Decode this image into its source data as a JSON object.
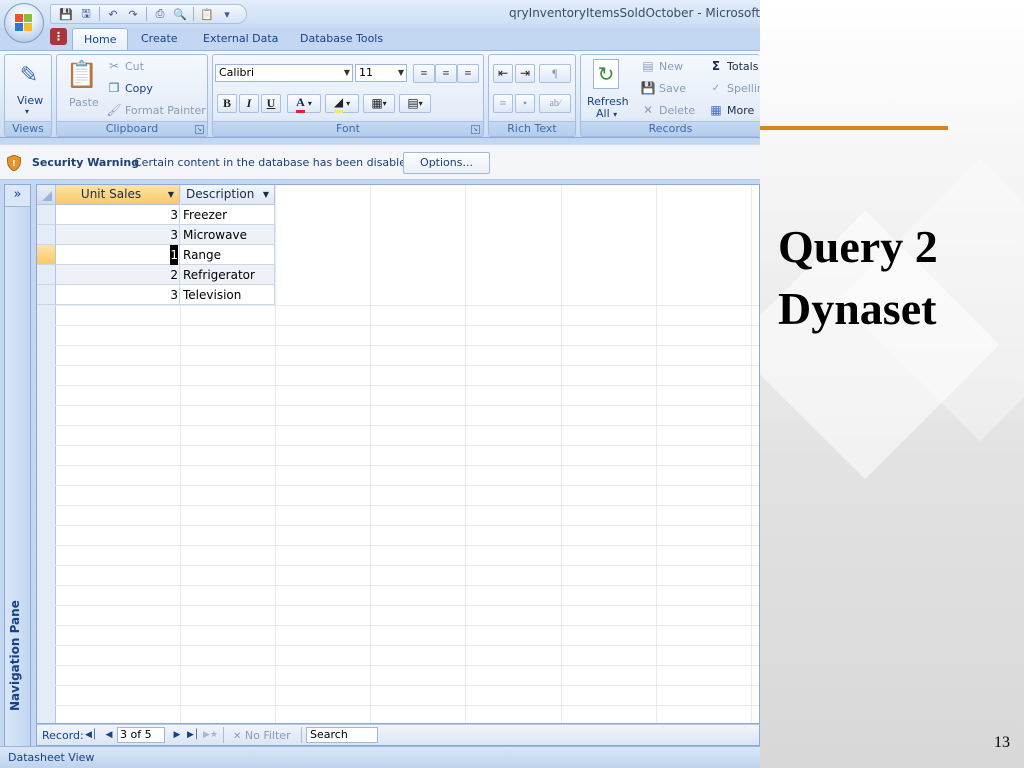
{
  "window": {
    "title": "qryInventoryItemsSoldOctober - Microsoft Acce"
  },
  "tabs": [
    "Home",
    "Create",
    "External Data",
    "Database Tools"
  ],
  "ribbon": {
    "views": {
      "view_label": "View",
      "group_label": "Views"
    },
    "clipboard": {
      "paste": "Paste",
      "cut": "Cut",
      "copy": "Copy",
      "format_painter": "Format Painter",
      "group_label": "Clipboard"
    },
    "font": {
      "font_name": "Calibri",
      "font_size": "11",
      "group_label": "Font"
    },
    "rich_text": {
      "group_label": "Rich Text"
    },
    "records": {
      "refresh_line1": "Refresh",
      "refresh_line2": "All",
      "new": "New",
      "save": "Save",
      "delete": "Delete",
      "totals": "Totals",
      "spelling": "Spellin",
      "more": "More",
      "group_label": "Records"
    }
  },
  "security": {
    "title": "Security Warning",
    "message": "Certain content in the database has been disabled",
    "options_label": "Options..."
  },
  "nav_pane": {
    "label": "Navigation Pane",
    "toggle": "»"
  },
  "datasheet": {
    "columns": [
      "Unit Sales",
      "Description"
    ],
    "rows": [
      {
        "unit_sales": "3",
        "description": "Freezer"
      },
      {
        "unit_sales": "3",
        "description": "Microwave"
      },
      {
        "unit_sales": "1",
        "description": "Range"
      },
      {
        "unit_sales": "2",
        "description": "Refrigerator"
      },
      {
        "unit_sales": "3",
        "description": "Television"
      }
    ],
    "current_row_index": 2
  },
  "record_nav": {
    "label": "Record:",
    "position": "3 of 5",
    "filter": "No Filter",
    "search": "Search"
  },
  "status": {
    "text": "Datasheet View"
  },
  "slide": {
    "title_line1": "Query 2",
    "title_line2": "Dynaset",
    "page_number": "13"
  },
  "colors": {
    "accent_line": "#d8861c",
    "active_header": "#fbc967",
    "ribbon_text": "#15428b"
  }
}
